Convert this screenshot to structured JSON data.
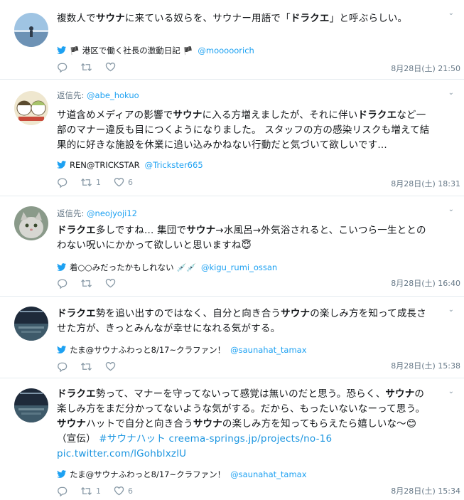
{
  "icons": {
    "reply": "reply-icon",
    "retweet": "retweet-icon",
    "like": "heart-icon",
    "more": "chevron-down-icon",
    "via": "twitter-bird-icon"
  },
  "colors": {
    "accent": "#1da1f2",
    "link": "#1b95e0",
    "muted": "#657786",
    "icon": "#8899a6"
  },
  "tweets": [
    {
      "reply_label": "",
      "reply_handle": "",
      "text": {
        "p1": "複数人で",
        "b1": "サウナ",
        "p2": "に来ている奴らを、サウナー用語で「",
        "b2": "ドラクエ",
        "p3": "」と呼ぶらしい。"
      },
      "via_name": "港区で働く社長の激動日記",
      "via_handle": "@mooooorich",
      "retweets": "",
      "likes": "",
      "time": "8月28日(土) 21:50"
    },
    {
      "reply_label": "返信先:",
      "reply_handle": "@abe_hokuo",
      "text": {
        "p1": "サ道含めメディアの影響で",
        "b1": "サウナ",
        "p2": "に入る方増えましたが、それに伴い",
        "b2": "ドラクエ",
        "p3": "など一部のマナー違反も目につくようになりました。 スタッフの方の感染リスクも増えて結果的に好きな施設を休業に追い込みかねない行動だと気づいて欲しいです…"
      },
      "via_name": "REN@TRICKSTAR",
      "via_handle": "@Trickster665",
      "retweets": "1",
      "likes": "6",
      "time": "8月28日(土) 18:31"
    },
    {
      "reply_label": "返信先:",
      "reply_handle": "@neojyoji12",
      "text": {
        "b1": "ドラクエ",
        "p1": "多しですね… 集団で",
        "b2": "サウナ",
        "p2": "→水風呂→外気浴されると、こいつら一生ととのわない呪いにかかって欲しいと思いますね",
        "emoji": "😇"
      },
      "via_name": "着○○みだったかもしれない",
      "via_emoji": "💉💉",
      "via_handle": "@kigu_rumi_ossan",
      "retweets": "",
      "likes": "",
      "time": "8月28日(土) 16:40"
    },
    {
      "reply_label": "",
      "reply_handle": "",
      "text": {
        "b1": "ドラクエ",
        "p1": "勢を追い出すのではなく、自分と向き合う",
        "b2": "サウナ",
        "p2": "の楽しみ方を知って成長させた方が、きっとみんなが幸せになれる気がする。"
      },
      "via_name": "たま@サウナふわっと8/17~クラファン！",
      "via_handle": "@saunahat_tamax",
      "retweets": "",
      "likes": "",
      "time": "8月28日(土) 15:38"
    },
    {
      "reply_label": "",
      "reply_handle": "",
      "text": {
        "b1": "ドラクエ",
        "p1": "勢って、マナーを守ってないって感覚は無いのだと思う。恐らく、",
        "b2": "サウナ",
        "p2": "の楽しみ方をまだ分かってないような気がする。だから、もったいないなーって思う。 ",
        "b3": "サウナ",
        "p3": "ハットで自分と向き合う",
        "b4": "サウナ",
        "p4": "の楽しみ方を知ってもらえたら嬉しいな〜",
        "emoji": "😊",
        "p5": "（宣伝） ",
        "hashtag": "#サウナハット",
        "url": "creema-springs.jp/projects/no-16",
        "pic": "pic.twitter.com/lGohblxzlU"
      },
      "via_name": "たま@サウナふわっと8/17~クラファン！",
      "via_handle": "@saunahat_tamax",
      "retweets": "1",
      "likes": "6",
      "time": "8月28日(土) 15:34"
    }
  ]
}
